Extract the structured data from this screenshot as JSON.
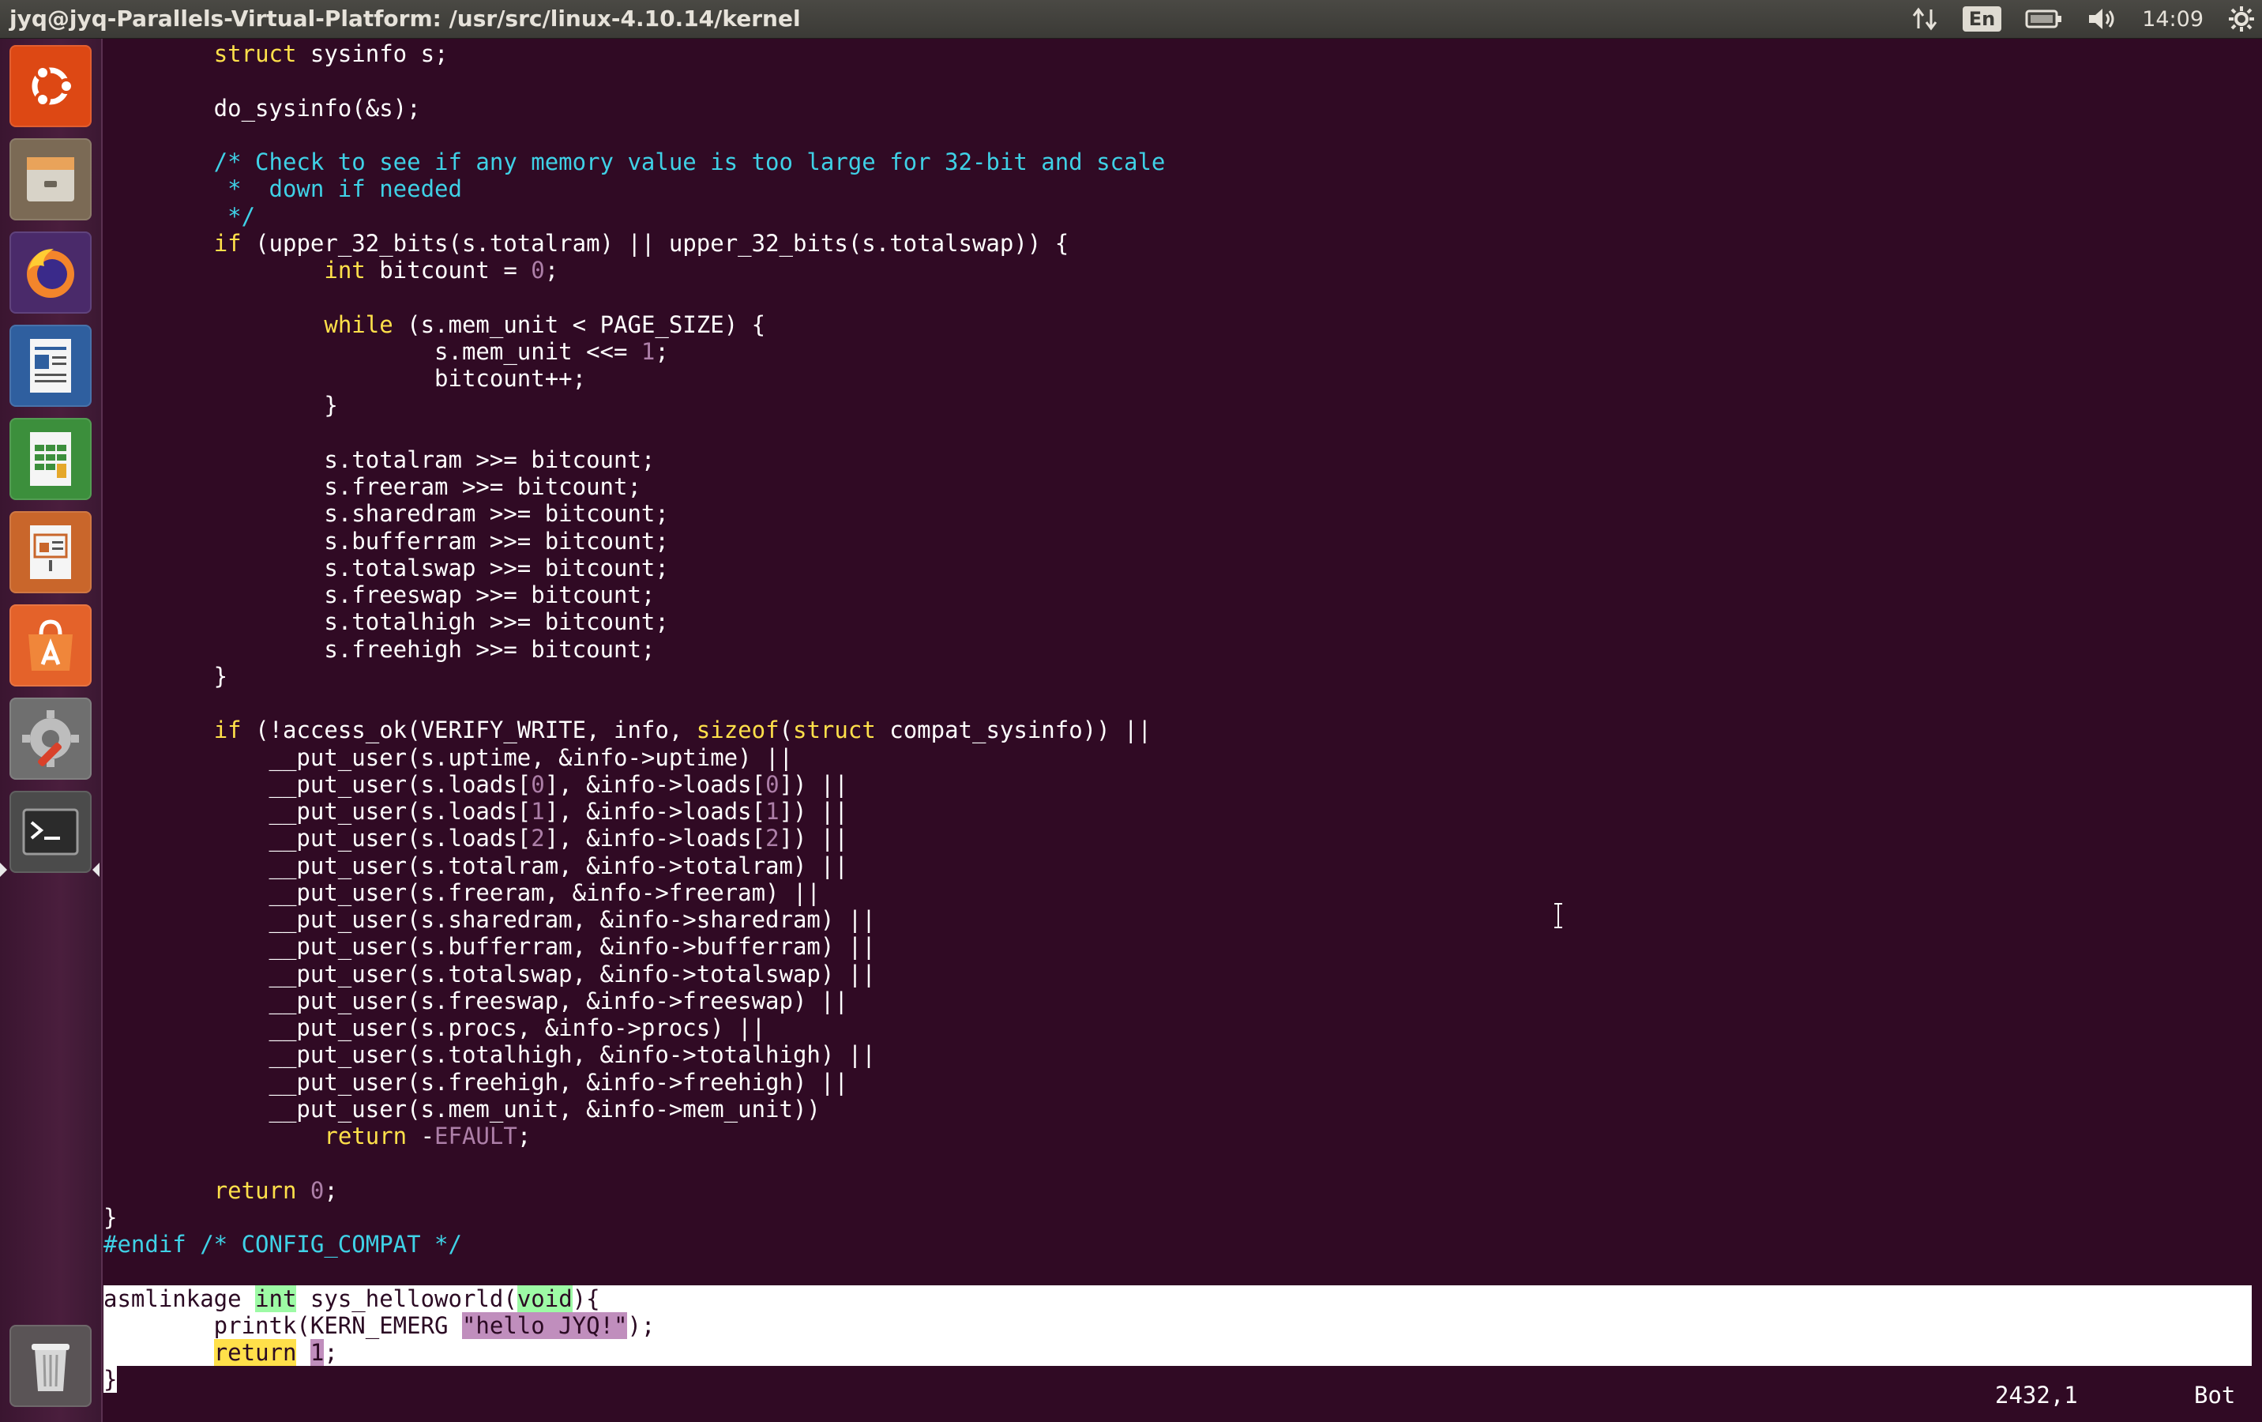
{
  "window": {
    "title": "jyq@jyq-Parallels-Virtual-Platform: /usr/src/linux-4.10.14/kernel"
  },
  "indicators": {
    "network_icon": "network-arrows-icon",
    "language": "En",
    "battery_icon": "battery-icon",
    "volume_icon": "volume-icon",
    "clock": "14:09",
    "settings_icon": "gear-icon"
  },
  "launcher": {
    "items": [
      {
        "name": "ubuntu-dash-icon"
      },
      {
        "name": "files-icon"
      },
      {
        "name": "firefox-icon"
      },
      {
        "name": "libreoffice-writer-icon"
      },
      {
        "name": "libreoffice-calc-icon"
      },
      {
        "name": "libreoffice-impress-icon"
      },
      {
        "name": "software-center-icon"
      },
      {
        "name": "system-settings-icon"
      },
      {
        "name": "terminal-icon"
      },
      {
        "name": "trash-icon"
      }
    ]
  },
  "code": {
    "lines": [
      "        struct sysinfo s;",
      "",
      "        do_sysinfo(&s);",
      "",
      "        /* Check to see if any memory value is too large for 32-bit and scale",
      "         *  down if needed",
      "         */",
      "        if (upper_32_bits(s.totalram) || upper_32_bits(s.totalswap)) {",
      "                int bitcount = 0;",
      "",
      "                while (s.mem_unit < PAGE_SIZE) {",
      "                        s.mem_unit <<= 1;",
      "                        bitcount++;",
      "                }",
      "",
      "                s.totalram >>= bitcount;",
      "                s.freeram >>= bitcount;",
      "                s.sharedram >>= bitcount;",
      "                s.bufferram >>= bitcount;",
      "                s.totalswap >>= bitcount;",
      "                s.freeswap >>= bitcount;",
      "                s.totalhigh >>= bitcount;",
      "                s.freehigh >>= bitcount;",
      "        }",
      "",
      "        if (!access_ok(VERIFY_WRITE, info, sizeof(struct compat_sysinfo)) ||",
      "            __put_user(s.uptime, &info->uptime) ||",
      "            __put_user(s.loads[0], &info->loads[0]) ||",
      "            __put_user(s.loads[1], &info->loads[1]) ||",
      "            __put_user(s.loads[2], &info->loads[2]) ||",
      "            __put_user(s.totalram, &info->totalram) ||",
      "            __put_user(s.freeram, &info->freeram) ||",
      "            __put_user(s.sharedram, &info->sharedram) ||",
      "            __put_user(s.bufferram, &info->bufferram) ||",
      "            __put_user(s.totalswap, &info->totalswap) ||",
      "            __put_user(s.freeswap, &info->freeswap) ||",
      "            __put_user(s.procs, &info->procs) ||",
      "            __put_user(s.totalhigh, &info->totalhigh) ||",
      "            __put_user(s.freehigh, &info->freehigh) ||",
      "            __put_user(s.mem_unit, &info->mem_unit))",
      "                return -EFAULT;",
      "",
      "        return 0;",
      "}",
      "#endif /* CONFIG_COMPAT */",
      "",
      "asmlinkage int sys_helloworld(void){",
      "        printk(KERN_EMERG \"hello JYQ!\");",
      "        return 1;",
      "}"
    ],
    "highlight_first": 46,
    "highlight_last": 48,
    "cursor_line": 49
  },
  "status": {
    "position": "2432,1",
    "scroll": "Bot"
  },
  "colors": {
    "background": "#300a24",
    "comment": "#3fd1e6",
    "keyword": "#ffe04a",
    "number": "#ad7fa8",
    "selection": "#ffffff"
  }
}
